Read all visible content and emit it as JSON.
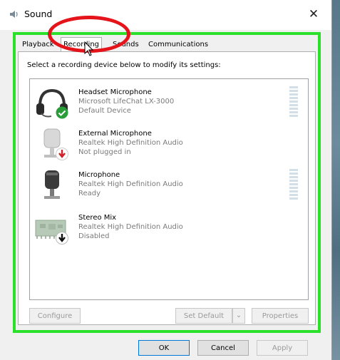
{
  "window": {
    "title": "Sound"
  },
  "tabs": [
    {
      "label": "Playback",
      "active": false
    },
    {
      "label": "Recording",
      "active": true
    },
    {
      "label": "Sounds",
      "active": false
    },
    {
      "label": "Communications",
      "active": false
    }
  ],
  "instruction": "Select a recording device below to modify its settings:",
  "devices": [
    {
      "name": "Headset Microphone",
      "line2": "Microsoft LifeChat LX-3000",
      "status": "Default Device",
      "icon": "headset-icon",
      "badge": "check-badge-icon",
      "badge_color": "#2a9d3a",
      "has_meter": true
    },
    {
      "name": "External Microphone",
      "line2": "Realtek High Definition Audio",
      "status": "Not plugged in",
      "icon": "external-mic-icon",
      "badge": "red-down-arrow-badge-icon",
      "badge_color": "#d0202a",
      "has_meter": false
    },
    {
      "name": "Microphone",
      "line2": "Realtek High Definition Audio",
      "status": "Ready",
      "icon": "microphone-icon",
      "badge": null,
      "has_meter": true
    },
    {
      "name": "Stereo Mix",
      "line2": "Realtek High Definition Audio",
      "status": "Disabled",
      "icon": "circuit-board-icon",
      "badge": "down-arrow-badge-icon",
      "badge_color": "#111111",
      "has_meter": false
    }
  ],
  "buttons": {
    "configure": "Configure",
    "set_default": "Set Default",
    "properties": "Properties",
    "ok": "OK",
    "cancel": "Cancel",
    "apply": "Apply"
  },
  "colors": {
    "highlight_frame": "#2be02b",
    "annotation_circle": "#e4141a"
  }
}
